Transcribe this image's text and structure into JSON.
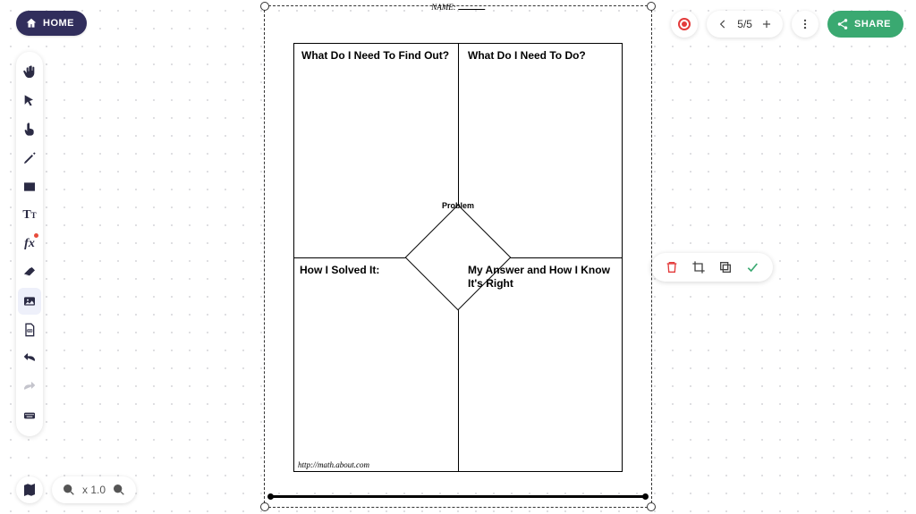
{
  "home_label": "HOME",
  "share_label": "SHARE",
  "page_indicator": "5/5",
  "zoom_label": "x 1.0",
  "worksheet": {
    "name_label": "NAME:",
    "q1": "What Do I Need To Find Out?",
    "q2": "What Do I Need To Do?",
    "q3": "How I Solved It:",
    "q4": "My Answer and How I Know It's Right",
    "center": "Problem",
    "footer": "http://math.about.com"
  }
}
